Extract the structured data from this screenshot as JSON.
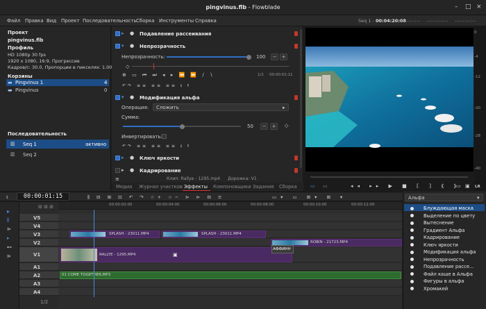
{
  "window": {
    "title_file": "pingvinus.flb",
    "title_sep": " - ",
    "title_app": "Flowblade"
  },
  "menu": [
    "Файл",
    "Правка",
    "Вид",
    "Проект",
    "Последовательность",
    "Сборка",
    "Инструменты",
    "Справка"
  ],
  "seq_status": {
    "name": "Seq 1 - ",
    "time": "00:04:20:08",
    "dashes": [
      "--:--:--:--",
      "--:--:--:--",
      "--:--:--:--"
    ]
  },
  "project": {
    "header": "Проект",
    "name": "pingvinus.flb",
    "profile_header": "Профиль",
    "profile_lines": [
      "HD 1080p 30 fps",
      "1920 x 1080, 16:9, Прогрессив",
      "Кадров/с: 30.0, Пропорции в пикселях: 1.00"
    ],
    "bins_header": "Корзины",
    "bins": [
      {
        "name": "Pingvinus 1",
        "count": "4"
      },
      {
        "name": "Pingvinus",
        "count": "0"
      }
    ],
    "seq_header": "Последовательность",
    "sequences": [
      {
        "name": "Seq 1",
        "status": "активно"
      },
      {
        "name": "Seq 2",
        "status": ""
      }
    ]
  },
  "effects": {
    "items": [
      {
        "name": "Подавление рассеивания"
      },
      {
        "name": "Непрозрачность"
      },
      {
        "name": "Модификация альфа"
      },
      {
        "name": "Ключ яркости"
      },
      {
        "name": "Кадрирование"
      }
    ],
    "opacity_label": "Непрозрачность:",
    "opacity_value": "100",
    "opacity_level": 1.0,
    "kf_counter": "1/1",
    "kf_time": "00:00:01:11",
    "operation_label": "Операция:",
    "operation_value": "Сложить",
    "sum_label": "Сумма:",
    "sum_value": "50",
    "sum_level": 0.5,
    "invert_label": "Инвертировать:",
    "clip_info": "Клип: Rallye - 1295.mp4",
    "track_info": "Дорожка: V1"
  },
  "tabs": [
    "Медиа",
    "Журнал участков",
    "Эффекты",
    "Компоновщики",
    "Задания",
    "Сборка"
  ],
  "active_tab": "Эффекты",
  "meter_ticks": [
    "0",
    "-4",
    "-12",
    "-20",
    "-28",
    "-40"
  ],
  "meter_lr": "LR",
  "timeline": {
    "timecode": "00:00:01:15",
    "ruler": [
      "00:00:02:00",
      "00:00:04:00",
      "00:00:06:00",
      "00:00:08:00",
      "00:00:10:00",
      "00:00:12:00"
    ],
    "tracks": [
      "V5",
      "V4",
      "V3",
      "V2",
      "V1",
      "A1",
      "A2",
      "A3",
      "A4"
    ],
    "clips": [
      {
        "label": "SPLASH - 23011.MP4"
      },
      {
        "label": "SPLASH - 23011.MP4"
      },
      {
        "label": "ROBIN - 21723.MP4"
      },
      {
        "label": "RALLYE - 1295.MP4"
      },
      {
        "label": "АФФИНН"
      },
      {
        "label": "01 COME TOGETHER.MP3"
      }
    ],
    "zoom": "1/2"
  },
  "filters": {
    "dropdown": "Альфа",
    "items": [
      "Блуждающая маска",
      "Выделение по цвету",
      "Вытеснение",
      "Градиент Альфа",
      "Кадрирование",
      "Ключ яркости",
      "Модификация альфа",
      "Непрозрачность",
      "Подавление рассе...",
      "Файл каше в Альфа",
      "Фигуры в альфа",
      "Хромакей"
    ],
    "selected_index": 0
  },
  "colors": {
    "accent": "#1d4d86",
    "video_clip": "#4a2a62",
    "audio_clip": "#2e6b2f",
    "trash": "#c0392b"
  }
}
